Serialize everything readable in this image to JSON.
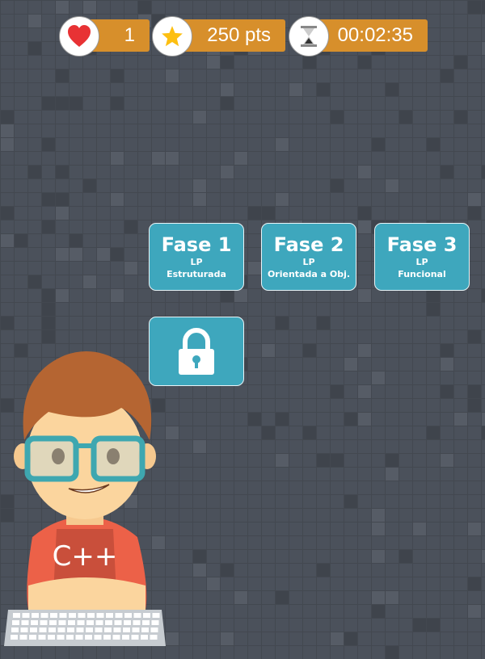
{
  "hud": {
    "lives": {
      "icon": "heart-icon",
      "value": "1"
    },
    "score": {
      "icon": "star-icon",
      "value": "250 pts"
    },
    "timer": {
      "icon": "hourglass-icon",
      "value": "00:02:35"
    }
  },
  "phases": [
    {
      "title": "Fase 1",
      "line1": "LP",
      "line2": "Estruturada"
    },
    {
      "title": "Fase 2",
      "line1": "LP",
      "line2": "Orientada a Obj."
    },
    {
      "title": "Fase 3",
      "line1": "LP",
      "line2": "Funcional"
    }
  ],
  "locked_phase": {
    "icon": "lock-icon"
  },
  "character": {
    "shirt_logo": "C++"
  },
  "colors": {
    "hud": "#d78f2b",
    "phase": "#3ea7bd",
    "background": "#4b515b"
  }
}
